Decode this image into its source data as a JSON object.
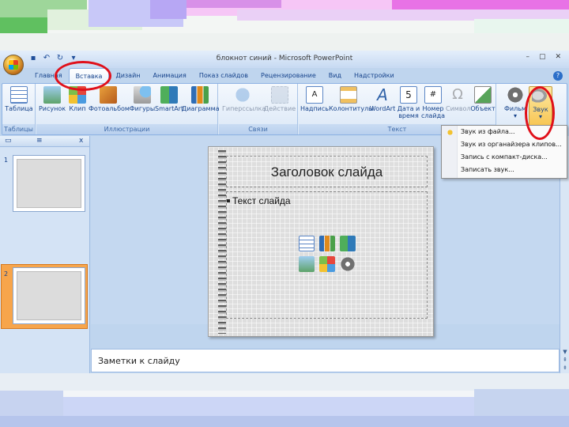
{
  "window": {
    "title": "блокнот синий - Microsoft PowerPoint",
    "controls": [
      "–",
      "▢",
      "✕"
    ]
  },
  "ribbon_tabs": [
    "Главная",
    "Вставка",
    "Дизайн",
    "Анимация",
    "Показ слайдов",
    "Рецензирование",
    "Вид",
    "Надстройки"
  ],
  "active_tab": "Вставка",
  "groups": {
    "tables": {
      "label": "Таблицы",
      "buttons": [
        "Таблица"
      ]
    },
    "illustrations": {
      "label": "Иллюстрации",
      "buttons": [
        "Рисунок",
        "Клип",
        "Фотоальбом",
        "Фигуры",
        "SmartArt",
        "Диаграмма"
      ]
    },
    "links": {
      "label": "Связи",
      "buttons": [
        "Гиперссылка",
        "Действие"
      ]
    },
    "text": {
      "label": "Текст",
      "buttons": [
        "Надпись",
        "Колонтитулы",
        "WordArt",
        "Дата и время",
        "Номер слайда",
        "Символ",
        "Объект"
      ]
    },
    "media": {
      "buttons": [
        "Фильм",
        "Звук"
      ]
    }
  },
  "sound_menu": {
    "items": [
      "Звук из файла...",
      "Звук из органайзера клипов...",
      "Запись с компакт-диска...",
      "Записать звук..."
    ]
  },
  "slides_panel": {
    "close": "x",
    "slides": [
      "1",
      "2"
    ]
  },
  "slide": {
    "title": "Заголовок слайда",
    "body": "Текст слайда"
  },
  "notes": {
    "placeholder": "Заметки к слайду"
  },
  "colors": {
    "annotation_circle": "#e0101a",
    "selected_slide": "#f7a54b",
    "ribbon_text": "#15428b"
  }
}
